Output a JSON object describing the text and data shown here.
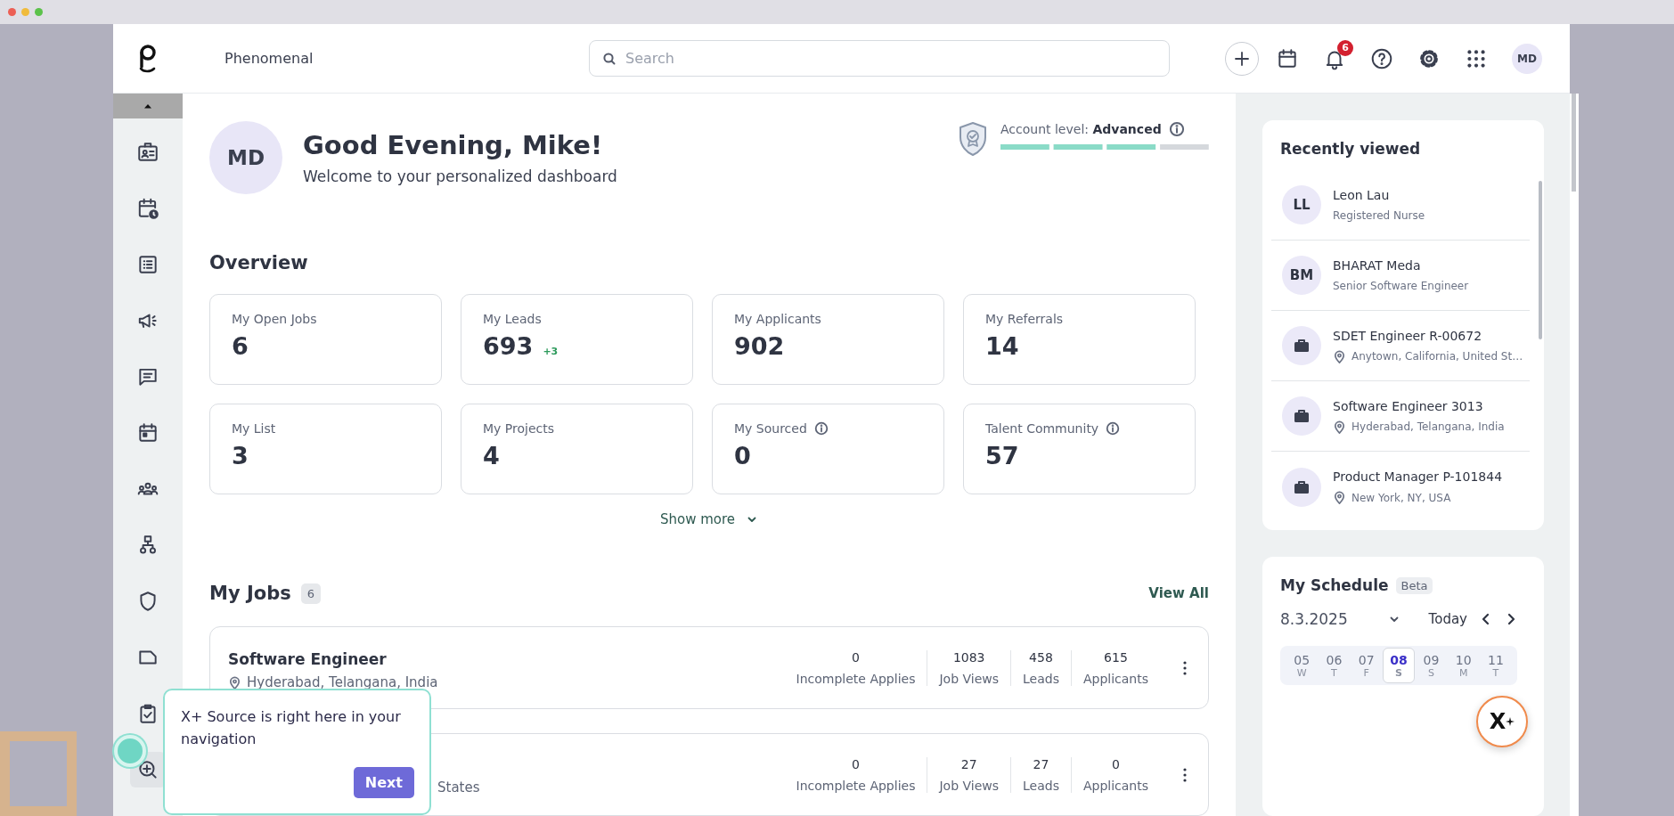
{
  "header": {
    "app_name": "Phenomenal",
    "search": {
      "placeholder": "Search"
    },
    "notification_count": "6",
    "avatar": "MD"
  },
  "greeting": {
    "avatar": "MD",
    "title": "Good Evening, Mike!",
    "subtitle": "Welcome to your personalized dashboard"
  },
  "account_level": {
    "label": "Account level:",
    "value": "Advanced",
    "level": 0.75
  },
  "overview": {
    "title": "Overview",
    "cards": [
      {
        "label": "My Open Jobs",
        "value": "6",
        "info": false
      },
      {
        "label": "My Leads",
        "value": "693",
        "delta": "+3",
        "info": false
      },
      {
        "label": "My Applicants",
        "value": "902",
        "info": false
      },
      {
        "label": "My Referrals",
        "value": "14",
        "info": false
      },
      {
        "label": "My List",
        "value": "3",
        "info": false
      },
      {
        "label": "My Projects",
        "value": "4",
        "info": false
      },
      {
        "label": "My Sourced",
        "value": "0",
        "info": true
      },
      {
        "label": "Talent Community",
        "value": "57",
        "info": true
      }
    ],
    "show_more": "Show more"
  },
  "my_jobs": {
    "title": "My Jobs",
    "count": "6",
    "view_all": "View All",
    "jobs": [
      {
        "title": "Software Engineer",
        "location": "Hyderabad, Telangana, India",
        "stats": [
          {
            "value": "0",
            "label": "Incomplete Applies"
          },
          {
            "value": "1083",
            "label": "Job Views"
          },
          {
            "value": "458",
            "label": "Leads"
          },
          {
            "value": "615",
            "label": "Applicants"
          }
        ]
      },
      {
        "location": "States",
        "stats": [
          {
            "value": "0",
            "label": "Incomplete Applies"
          },
          {
            "value": "27",
            "label": "Job Views"
          },
          {
            "value": "27",
            "label": "Leads"
          },
          {
            "value": "0",
            "label": "Applicants"
          }
        ]
      }
    ]
  },
  "recently_viewed": {
    "title": "Recently viewed",
    "items": [
      {
        "kind": "person",
        "initials": "LL",
        "name": "Leon Lau",
        "subtitle": "Registered Nurse"
      },
      {
        "kind": "person",
        "initials": "BM",
        "name": "BHARAT Meda",
        "subtitle": "Senior Software Engineer"
      },
      {
        "kind": "job",
        "name": "SDET Engineer R-00672",
        "subtitle": "Anytown, California, United St…"
      },
      {
        "kind": "job",
        "name": "Software Engineer 3013",
        "subtitle": "Hyderabad, Telangana, India"
      },
      {
        "kind": "job",
        "name": "Product Manager P-101844",
        "subtitle": "New York, NY, USA"
      }
    ]
  },
  "schedule": {
    "title": "My Schedule",
    "badge": "Beta",
    "date": "8.3.2025",
    "today": "Today",
    "days": [
      {
        "day": "05",
        "weekday": "W",
        "selected": false
      },
      {
        "day": "06",
        "weekday": "T",
        "selected": false
      },
      {
        "day": "07",
        "weekday": "F",
        "selected": false
      },
      {
        "day": "08",
        "weekday": "S",
        "selected": true
      },
      {
        "day": "09",
        "weekday": "S",
        "selected": false
      },
      {
        "day": "10",
        "weekday": "M",
        "selected": false
      },
      {
        "day": "11",
        "weekday": "T",
        "selected": false
      }
    ]
  },
  "assistant_button": {
    "label": "X"
  },
  "tooltip": {
    "text": "X+ Source is right here in your navigation",
    "button": "Next"
  }
}
